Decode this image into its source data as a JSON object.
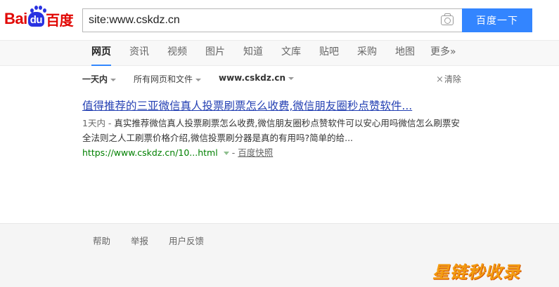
{
  "logo": {
    "latin1": "Bai",
    "latin2": "du",
    "chinese": "百度"
  },
  "search": {
    "value": "site:www.cskdz.cn",
    "button_label": "百度一下"
  },
  "tabs": [
    {
      "label": "网页",
      "active": true
    },
    {
      "label": "资讯"
    },
    {
      "label": "视频"
    },
    {
      "label": "图片"
    },
    {
      "label": "知道"
    },
    {
      "label": "文库"
    },
    {
      "label": "贴吧"
    },
    {
      "label": "采购"
    },
    {
      "label": "地图"
    },
    {
      "label": "更多»"
    }
  ],
  "filters": {
    "time": "一天内",
    "type": "所有网页和文件",
    "site": "www.cskdz.cn",
    "clear": "清除"
  },
  "result": {
    "title": "值得推荐的三亚微信真人投票刷票怎么收费,微信朋友圈秒点赞软件...",
    "date": "1天内 - ",
    "abstract": "真实推荐微信真人投票刷票怎么收费,微信朋友圈秒点赞软件可以安心用吗微信怎么刷票安全法则之人工刷票价格介绍,微信投票刷分器是真的有用吗?简单的给...",
    "url": "https://www.cskdz.cn/10...html",
    "separator": "-",
    "cache": "百度快照"
  },
  "footer": {
    "links": [
      "帮助",
      "举报",
      "用户反馈"
    ]
  },
  "watermark": "星链秒收录",
  "colors": {
    "accent": "#3385ff",
    "link": "#2440b3",
    "url": "#008000",
    "logo_red": "#e10602",
    "logo_blue": "#2932e1"
  }
}
